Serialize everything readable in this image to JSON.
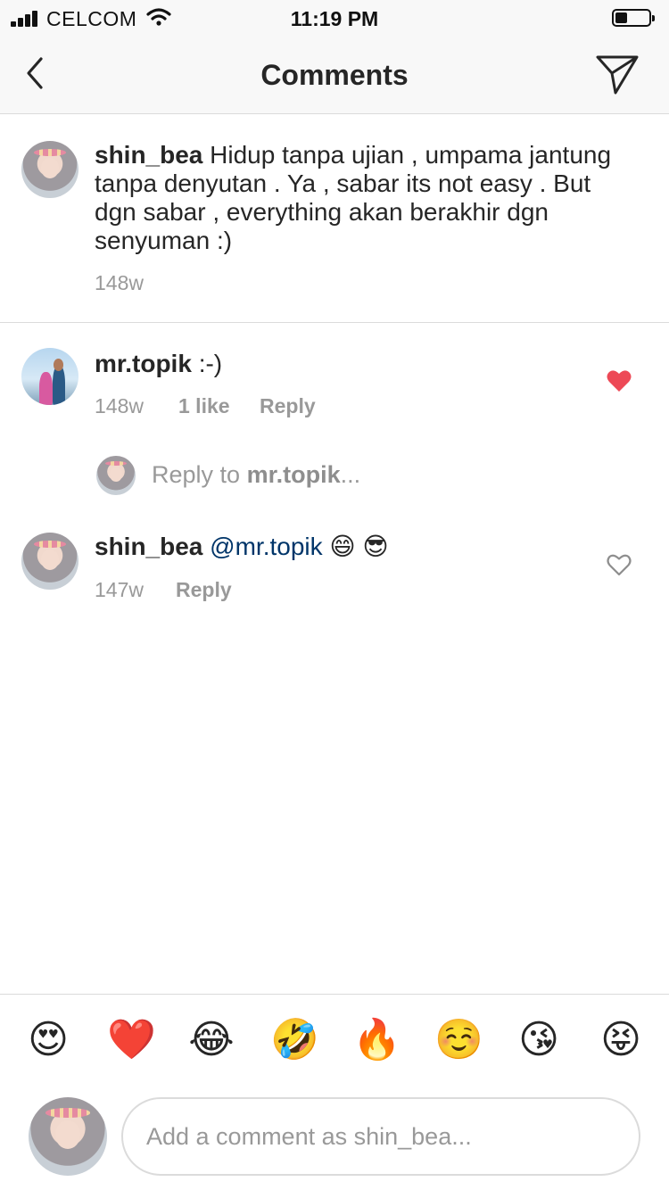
{
  "status_bar": {
    "carrier": "CELCOM",
    "time": "11:19 PM",
    "battery_level": 0.35
  },
  "header": {
    "title": "Comments",
    "back_icon": "chevron-left-icon",
    "share_icon": "paper-plane-icon"
  },
  "caption": {
    "username": "shin_bea",
    "text": " Hidup tanpa ujian , umpama jantung tanpa denyutan . Ya , sabar its not easy . But dgn sabar , everything akan berakhir dgn senyuman :)",
    "time": "148w"
  },
  "comments": [
    {
      "username": "mr.topik",
      "text": " :-)",
      "time": "148w",
      "likes": "1 like",
      "reply_label": "Reply",
      "liked": true
    },
    {
      "username": "shin_bea",
      "mention": "@mr.topik",
      "text": " 😄 😎",
      "time": "147w",
      "reply_label": "Reply",
      "liked": false
    }
  ],
  "reply_prompt": {
    "prefix": "Reply to ",
    "target": "mr.topik",
    "suffix": "..."
  },
  "emoji_bar": [
    "😍",
    "❤️",
    "😂",
    "🤣",
    "🔥",
    "☺️",
    "😘",
    "😝"
  ],
  "composer": {
    "placeholder": "Add a comment as shin_bea..."
  },
  "colors": {
    "like_red": "#ed4956",
    "mention_blue": "#003569",
    "meta_gray": "#999999"
  }
}
